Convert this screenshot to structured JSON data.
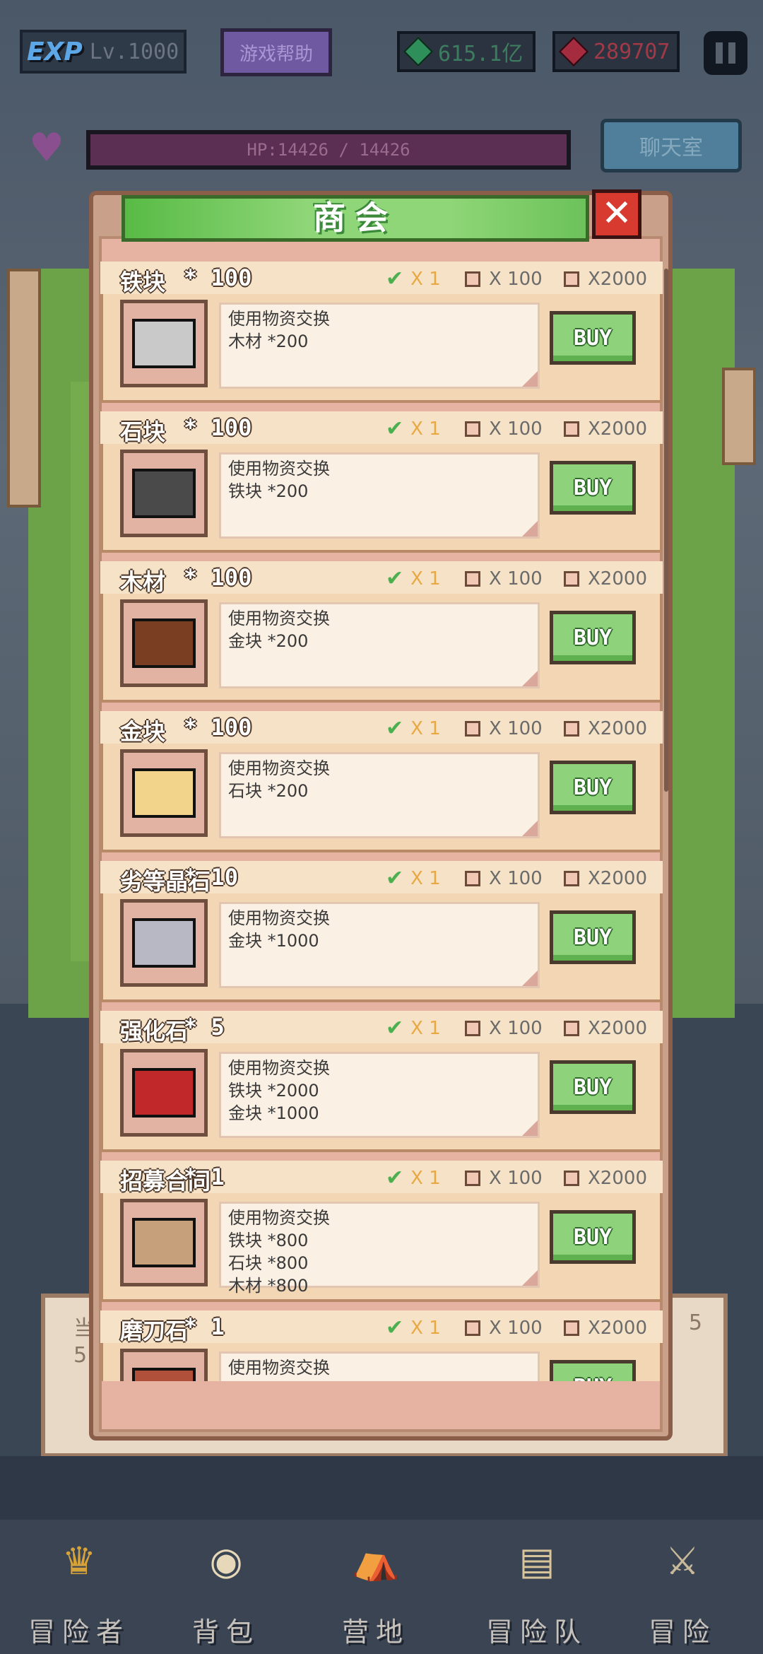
{
  "hud": {
    "exp_label": "EXP",
    "level": "Lv.1000",
    "help_button": "游戏帮助",
    "gems": "615.1亿",
    "rubies": "289707",
    "hp_text": "HP:14426 / 14426",
    "chat_button": "聊天室"
  },
  "modal": {
    "title": "商会",
    "close_symbol": "✕"
  },
  "options": {
    "x1": "X 1",
    "x100": "X 100",
    "x2000": "X2000"
  },
  "buy_label": "BUY",
  "items": [
    {
      "name": "铁块",
      "qty": "* 100",
      "desc": [
        "使用物资交换",
        "木材 *200"
      ],
      "color": "#c9c9c9"
    },
    {
      "name": "石块",
      "qty": "* 100",
      "desc": [
        "使用物资交换",
        "铁块 *200"
      ],
      "color": "#4a4a4a"
    },
    {
      "name": "木材",
      "qty": "* 100",
      "desc": [
        "使用物资交换",
        "金块 *200"
      ],
      "color": "#7a3f22"
    },
    {
      "name": "金块",
      "qty": "* 100",
      "desc": [
        "使用物资交换",
        "石块 *200"
      ],
      "color": "#f2d58a"
    },
    {
      "name": "劣等晶石",
      "qty": "* 10",
      "desc": [
        "使用物资交换",
        "金块 *1000"
      ],
      "color": "#b8b8c4"
    },
    {
      "name": "强化石",
      "qty": "* 5",
      "desc": [
        "使用物资交换",
        "铁块 *2000",
        "金块 *1000"
      ],
      "color": "#c0282a"
    },
    {
      "name": "招募合同",
      "qty": "* 1",
      "desc": [
        "使用物资交换",
        "铁块 *800",
        "石块 *800",
        "木材 *800"
      ],
      "color": "#c6a07a"
    },
    {
      "name": "磨刀石",
      "qty": "* 1",
      "desc": [
        "使用物资交换"
      ],
      "color": "#b0503a"
    }
  ],
  "background": {
    "card_left_text": "当",
    "card_left_num": "5",
    "card_right_num": "5"
  },
  "nav": [
    {
      "label": "冒险者",
      "icon": "crown-icon",
      "glyph": "♛",
      "color": "#d6a23a"
    },
    {
      "label": "背包",
      "icon": "backpack-icon",
      "glyph": "◉",
      "color": "#e6d8b8"
    },
    {
      "label": "营地",
      "icon": "tent-icon",
      "glyph": "⛺",
      "color": "#3a6fc2"
    },
    {
      "label": "冒险队",
      "icon": "book-icon",
      "glyph": "▤",
      "color": "#d8c49a"
    },
    {
      "label": "冒险",
      "icon": "sword-icon",
      "glyph": "⚔",
      "color": "#c7b99a"
    }
  ]
}
